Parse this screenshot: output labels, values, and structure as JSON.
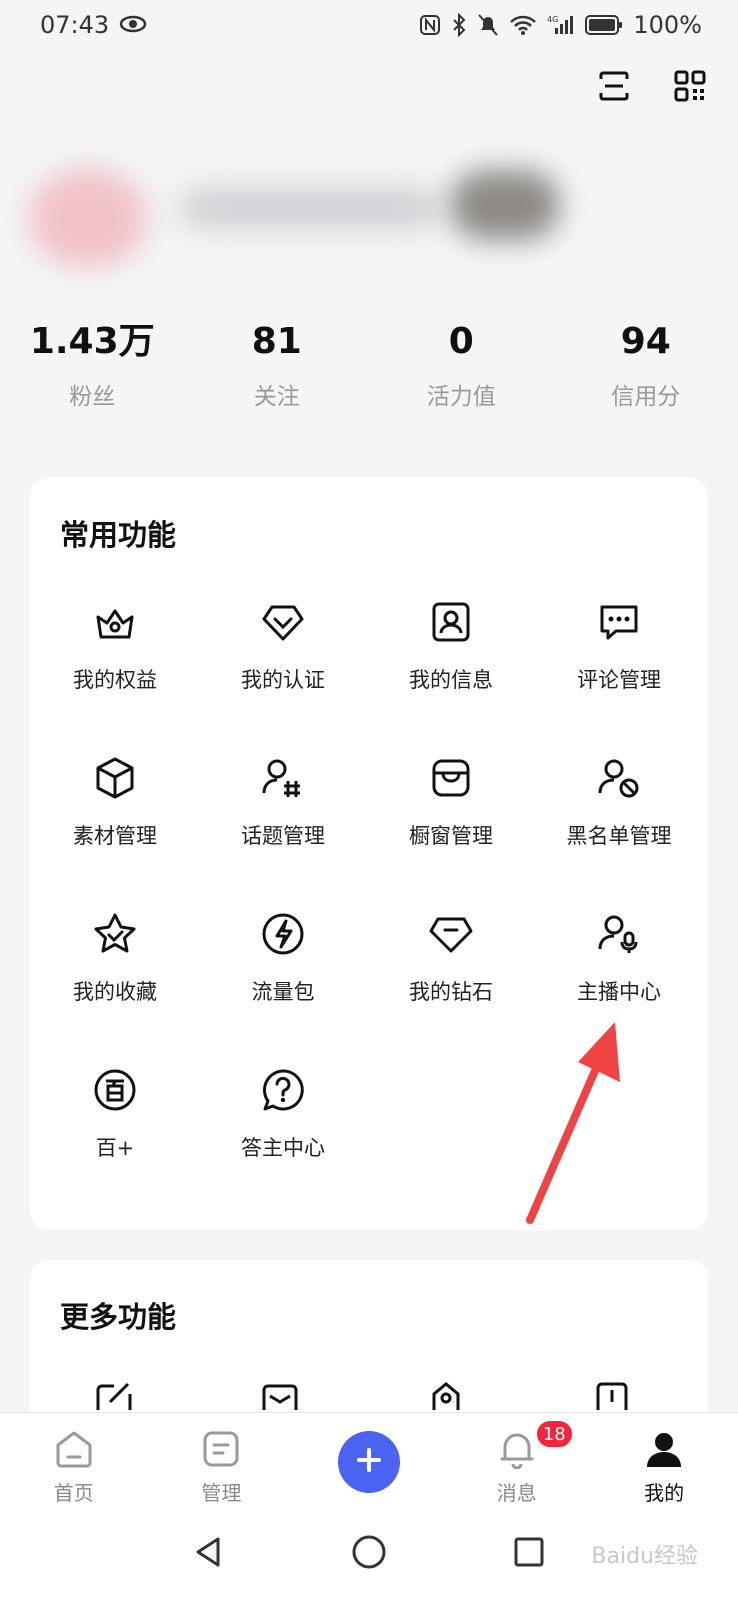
{
  "status_bar": {
    "time": "07:43",
    "battery": "100%",
    "network": "4G"
  },
  "stats": [
    {
      "value": "1.43万",
      "label": "粉丝"
    },
    {
      "value": "81",
      "label": "关注"
    },
    {
      "value": "0",
      "label": "活力值"
    },
    {
      "value": "94",
      "label": "信用分"
    }
  ],
  "common_functions": {
    "title": "常用功能",
    "items": [
      {
        "label": "我的权益",
        "icon": "crown-icon"
      },
      {
        "label": "我的认证",
        "icon": "verified-icon"
      },
      {
        "label": "我的信息",
        "icon": "profile-card-icon"
      },
      {
        "label": "评论管理",
        "icon": "comment-icon"
      },
      {
        "label": "素材管理",
        "icon": "cube-icon"
      },
      {
        "label": "话题管理",
        "icon": "topic-icon"
      },
      {
        "label": "橱窗管理",
        "icon": "shop-icon"
      },
      {
        "label": "黑名单管理",
        "icon": "blacklist-icon"
      },
      {
        "label": "我的收藏",
        "icon": "star-icon"
      },
      {
        "label": "流量包",
        "icon": "lightning-icon"
      },
      {
        "label": "我的钻石",
        "icon": "diamond-icon"
      },
      {
        "label": "主播中心",
        "icon": "anchor-icon"
      },
      {
        "label": "百+",
        "icon": "bai-plus-icon"
      },
      {
        "label": "答主中心",
        "icon": "question-icon"
      }
    ]
  },
  "more_functions": {
    "title": "更多功能"
  },
  "bottom_nav": {
    "items": [
      {
        "label": "首页",
        "icon": "home-icon"
      },
      {
        "label": "管理",
        "icon": "manage-icon"
      },
      {
        "label": "",
        "icon": "plus-icon"
      },
      {
        "label": "消息",
        "icon": "bell-icon",
        "badge": "18"
      },
      {
        "label": "我的",
        "icon": "user-icon"
      }
    ]
  },
  "colors": {
    "accent": "#4a63f0",
    "badge": "#f5243a",
    "annotation_arrow": "#f04444"
  },
  "watermark": "Baidu经验"
}
